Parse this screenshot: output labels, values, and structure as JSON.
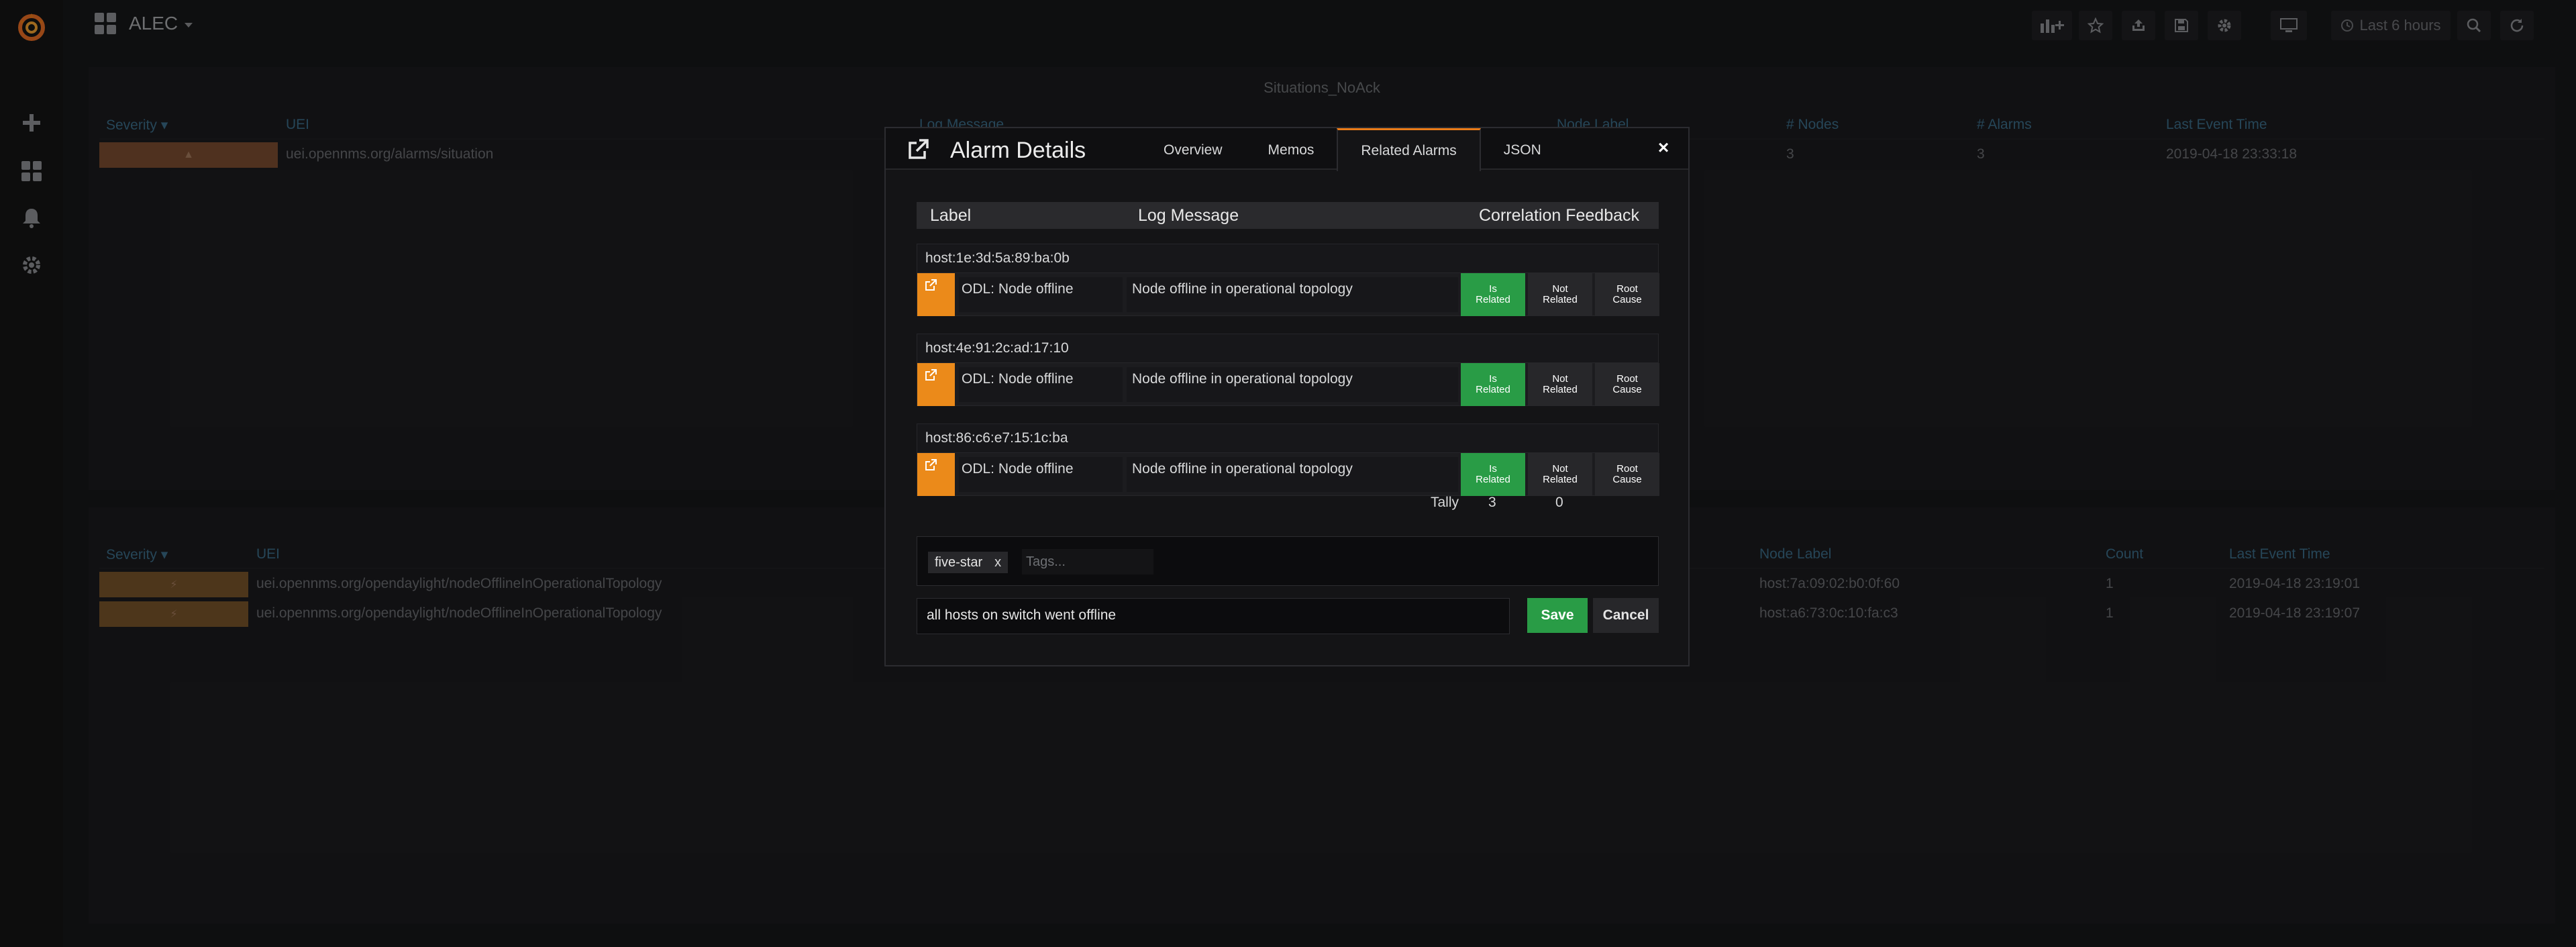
{
  "topbar": {
    "dashboard_name": "ALEC",
    "time_range": "Last 6 hours"
  },
  "situations_panel": {
    "title": "Situations_NoAck",
    "headers": [
      "Severity ▾",
      "UEI",
      "Log Message",
      "Node Label",
      "# Nodes",
      "# Alarms",
      "Last Event Time"
    ],
    "rows": [
      {
        "uei": "uei.opennms.org/alarms/situation",
        "nodes": "3",
        "alarms": "3",
        "last_event": "2019-04-18 23:33:18"
      }
    ]
  },
  "alarms_panel": {
    "headers": [
      "Severity ▾",
      "UEI",
      "Node Label",
      "Count",
      "Last Event Time"
    ],
    "rows": [
      {
        "uei": "uei.opennms.org/opendaylight/nodeOfflineInOperationalTopology",
        "node_label": "host:7a:09:02:b0:0f:60",
        "count": "1",
        "last_event": "2019-04-18 23:19:01"
      },
      {
        "uei": "uei.opennms.org/opendaylight/nodeOfflineInOperationalTopology",
        "node_label": "host:a6:73:0c:10:fa:c3",
        "count": "1",
        "last_event": "2019-04-18 23:19:07"
      }
    ]
  },
  "modal": {
    "title": "Alarm Details",
    "close": "×",
    "tabs": [
      "Overview",
      "Memos",
      "Related Alarms",
      "JSON"
    ],
    "active_tab": "Related Alarms",
    "columns": {
      "label": "Label",
      "log_message": "Log Message",
      "feedback": "Correlation Feedback"
    },
    "groups": [
      {
        "host": "host:1e:3d:5a:89:ba:0b",
        "label": "ODL: Node offline",
        "log_message": "Node offline in operational topology"
      },
      {
        "host": "host:4e:91:2c:ad:17:10",
        "label": "ODL: Node offline",
        "log_message": "Node offline in operational topology"
      },
      {
        "host": "host:86:c6:e7:15:1c:ba",
        "label": "ODL: Node offline",
        "log_message": "Node offline in operational topology"
      }
    ],
    "feedback_buttons": {
      "is_related": [
        "Is",
        "Related"
      ],
      "not_related": [
        "Not",
        "Related"
      ],
      "root_cause": [
        "Root",
        "Cause"
      ]
    },
    "tally": {
      "label": "Tally",
      "related": "3",
      "not_related": "0"
    },
    "tags": {
      "items": [
        "five-star"
      ],
      "remove": "x",
      "placeholder": "Tags..."
    },
    "memo": {
      "value": "all hosts on switch went offline"
    },
    "buttons": {
      "save": "Save",
      "cancel": "Cancel"
    }
  },
  "colors": {
    "accent_orange": "#eb8a1a",
    "related_green": "#299c46",
    "active_tab_border": "#eb7b18"
  }
}
